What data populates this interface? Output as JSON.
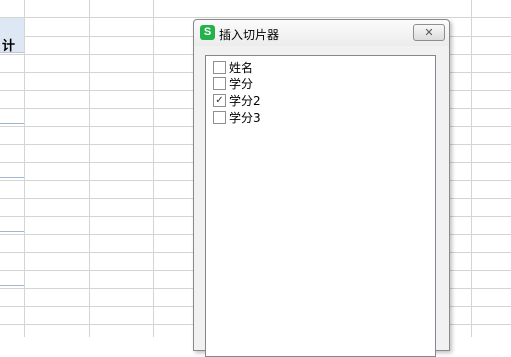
{
  "sheet": {
    "header_partial_text": "计"
  },
  "dialog": {
    "app_icon_glyph": "S",
    "title": "插入切片器",
    "close_label": "✕",
    "items": [
      {
        "label": "姓名",
        "checked": false
      },
      {
        "label": "学分",
        "checked": false
      },
      {
        "label": "学分2",
        "checked": true
      },
      {
        "label": "学分3",
        "checked": false
      }
    ]
  },
  "colors": {
    "app_icon": "#24b24b",
    "header_fill": "#dde8f4"
  }
}
